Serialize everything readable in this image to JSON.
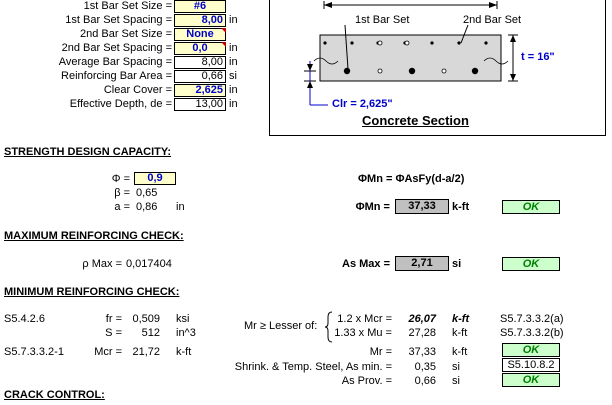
{
  "inputs": [
    {
      "label": "1st Bar Set Size =",
      "value": "#6",
      "unit": ""
    },
    {
      "label": "1st Bar Set Spacing =",
      "value": "8,00",
      "unit": "in"
    },
    {
      "label": "2nd Bar Set Size =",
      "value": "None",
      "unit": ""
    },
    {
      "label": "2nd Bar Set Spacing =",
      "value": "0,0",
      "unit": "in"
    },
    {
      "label": "Average Bar Spacing =",
      "value": "8,00",
      "unit": "in"
    },
    {
      "label": "Reinforcing Bar Area =",
      "value": "0,66",
      "unit": "si"
    },
    {
      "label": "Clear Cover =",
      "value": "2,625",
      "unit": "in"
    },
    {
      "label": "Effective Depth, de =",
      "value": "13,00",
      "unit": "in"
    }
  ],
  "section": {
    "label_1st": "1st Bar Set",
    "label_2nd": "2nd Bar Set",
    "thickness": "t = 16\"",
    "clr": "Clr = 2,625\"",
    "title": "Concrete Section"
  },
  "strength": {
    "header": "STRENGTH DESIGN CAPACITY:",
    "phi_label": "Φ =",
    "phi_value": "0,9",
    "beta_label": "β =",
    "beta_value": "0,65",
    "a_label": "a =",
    "a_value": "0,86",
    "a_unit": "in",
    "formula": "ΦMn = ΦAsFy(d-a/2)",
    "mn_label": "ΦMn =",
    "mn_value": "37,33",
    "mn_unit": "k-ft",
    "mn_status": "OK"
  },
  "max": {
    "header": "MAXIMUM REINFORCING CHECK:",
    "rho_label": "ρ Max =",
    "rho_value": "0,017404",
    "as_label": "As Max =",
    "as_value": "2,71",
    "as_unit": "si",
    "status": "OK"
  },
  "min": {
    "header": "MINIMUM REINFORCING CHECK:",
    "ref1": "S5.4.2.6",
    "fr_label": "fr =",
    "fr_value": "0,509",
    "fr_unit": "ksi",
    "s_label": "S =",
    "s_value": "512",
    "s_unit": "in^3",
    "ref2": "S5.7.3.3.2-1",
    "mcr_label": "Mcr =",
    "mcr_value": "21,72",
    "mcr_unit": "k-ft",
    "lesser_label": "Mr ≥ Lesser of:",
    "l1_label": "1.2 x Mcr =",
    "l1_value": "26,07",
    "l1_unit": "k-ft",
    "l1_ref": "S5.7.3.3.2(a)",
    "l2_label": "1.33 x Mu =",
    "l2_value": "27,28",
    "l2_unit": "k-ft",
    "l2_ref": "S5.7.3.3.2(b)",
    "mr_label": "Mr =",
    "mr_value": "37,33",
    "mr_unit": "k-ft",
    "mr_status": "OK",
    "shrink_label": "Shrink. & Temp. Steel, As min. =",
    "shrink_value": "0,35",
    "shrink_unit": "si",
    "shrink_ref": "S5.10.8.2",
    "asprov_label": "As Prov. =",
    "asprov_value": "0,66",
    "asprov_unit": "si",
    "asprov_status": "OK"
  },
  "crack": {
    "header": "CRACK CONTROL:"
  }
}
